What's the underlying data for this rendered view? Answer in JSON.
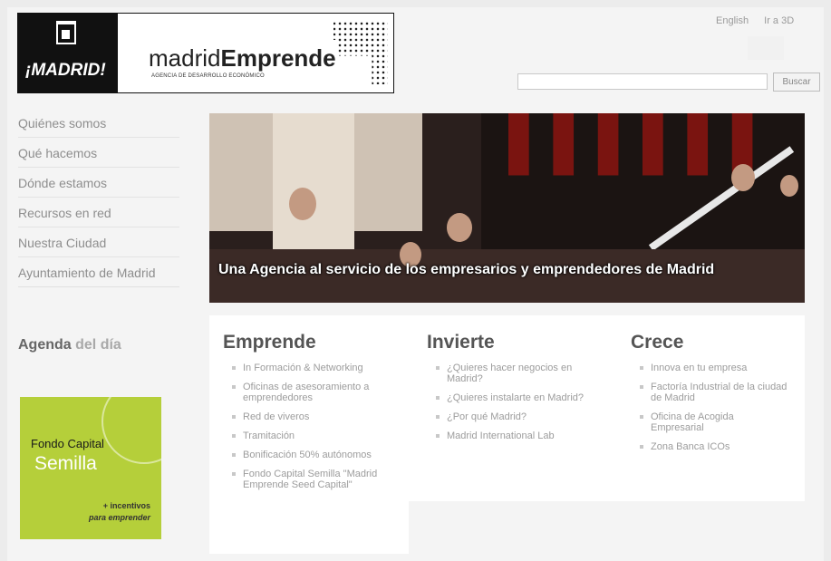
{
  "header": {
    "city_logo_text": "¡MADRID!",
    "brand_light": "madrid",
    "brand_bold": "Emprende",
    "brand_subtitle": "AGENCIA DE DESARROLLO ECONÓMICO",
    "top_links": [
      "English",
      "Ir a 3D"
    ],
    "search_placeholder": "",
    "search_button": "Buscar"
  },
  "sidebar": {
    "items": [
      {
        "label": "Quiénes somos"
      },
      {
        "label": "Qué hacemos"
      },
      {
        "label": "Dónde estamos"
      },
      {
        "label": "Recursos en red"
      },
      {
        "label": "Nuestra Ciudad"
      },
      {
        "label": "Ayuntamiento de Madrid"
      }
    ],
    "agenda_bold": "Agenda",
    "agenda_light": "del día",
    "promo": {
      "line1": "Fondo Capital",
      "line2": "Semilla",
      "line3": "+ incentivos",
      "line4": "para emprender"
    }
  },
  "hero": {
    "caption": "Una Agencia al servicio de los empresarios y emprendedores de Madrid"
  },
  "columns": [
    {
      "title": "Emprende",
      "items": [
        "In Formación & Networking",
        "Oficinas de asesoramiento a emprendedores",
        "Red de viveros",
        "Tramitación",
        "Bonificación 50% autónomos",
        "Fondo Capital Semilla \"Madrid Emprende Seed Capital\""
      ]
    },
    {
      "title": "Invierte",
      "items": [
        "¿Quieres hacer negocios en Madrid?",
        "¿Quieres instalarte en Madrid?",
        "¿Por qué Madrid?",
        "Madrid International Lab"
      ]
    },
    {
      "title": "Crece",
      "items": [
        "Innova en tu empresa",
        "Factoría Industrial de la ciudad de Madrid",
        "Oficina de Acogida Empresarial",
        "Zona Banca ICOs"
      ]
    }
  ]
}
